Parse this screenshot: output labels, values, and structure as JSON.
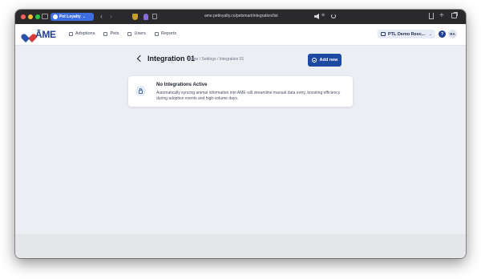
{
  "browser": {
    "tab_group_label": "Pet Loyalty",
    "url": "ame.petloyalty.co/petsmart/integration/list",
    "mute_state": "🔈 ⊘"
  },
  "header": {
    "logo_text": "ĀME",
    "nav": [
      {
        "label": "Adoptions",
        "icon": "adoptions-icon"
      },
      {
        "label": "Pets",
        "icon": "pets-icon"
      },
      {
        "label": "Users",
        "icon": "users-icon"
      },
      {
        "label": "Reports",
        "icon": "reports-icon"
      }
    ],
    "org_name": "PTL Demo Resc...",
    "help_label": "?",
    "avatar_initials": "RA"
  },
  "page": {
    "title": "Integration 01",
    "breadcrumb": "Home / Settings / Integration 01",
    "add_button_label": "Add new"
  },
  "empty_state": {
    "title": "No Integrations Active",
    "description": "Automatically syncing animal information into AME will streamline manual data entry, boosting efficiency during adoption events and high-volume days."
  },
  "colors": {
    "accent": "#1f4aa3",
    "brand_blue": "#1f3f93",
    "brand_red": "#d93a3a",
    "page_bg": "#eceef3"
  }
}
